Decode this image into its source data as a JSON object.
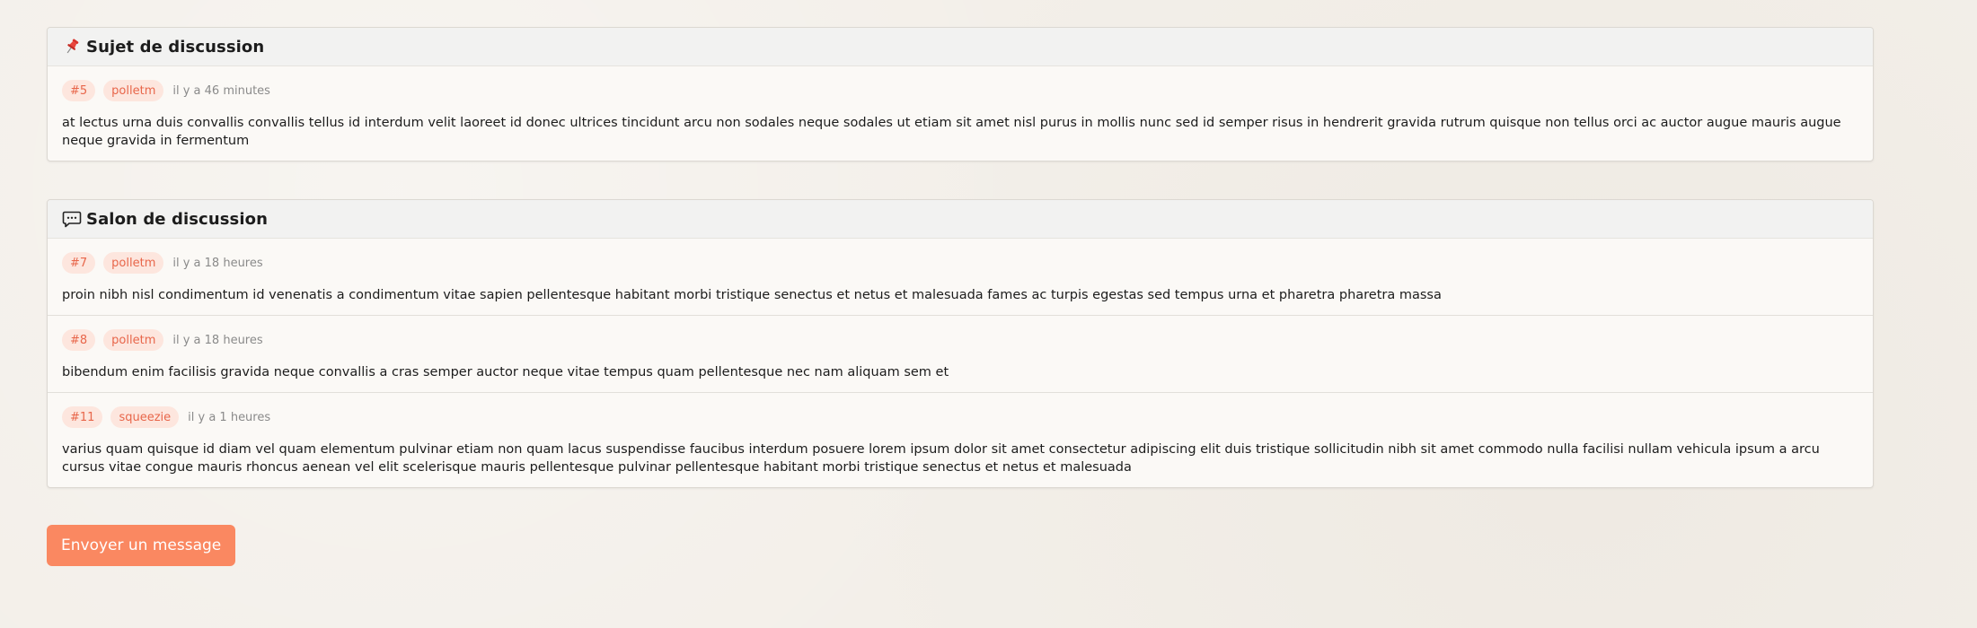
{
  "subject": {
    "title": "Sujet de discussion",
    "icon": "pushpin-icon",
    "message": {
      "id": "#5",
      "author": "polletm",
      "time": "il y a 46 minutes",
      "text": "at lectus urna duis convallis convallis tellus id interdum velit laoreet id donec ultrices tincidunt arcu non sodales neque sodales ut etiam sit amet nisl purus in mollis nunc sed id semper risus in hendrerit gravida rutrum quisque non tellus orci ac auctor augue mauris augue neque gravida in fermentum"
    }
  },
  "chat": {
    "title": "Salon de discussion",
    "icon": "chat-bubble-icon",
    "messages": [
      {
        "id": "#7",
        "author": "polletm",
        "time": "il y a 18 heures",
        "text": "proin nibh nisl condimentum id venenatis a condimentum vitae sapien pellentesque habitant morbi tristique senectus et netus et malesuada fames ac turpis egestas sed tempus urna et pharetra pharetra massa"
      },
      {
        "id": "#8",
        "author": "polletm",
        "time": "il y a 18 heures",
        "text": "bibendum enim facilisis gravida neque convallis a cras semper auctor neque vitae tempus quam pellentesque nec nam aliquam sem et"
      },
      {
        "id": "#11",
        "author": "squeezie",
        "time": "il y a 1 heures",
        "text": "varius quam quisque id diam vel quam elementum pulvinar etiam non quam lacus suspendisse faucibus interdum posuere lorem ipsum dolor sit amet consectetur adipiscing elit duis tristique sollicitudin nibh sit amet commodo nulla facilisi nullam vehicula ipsum a arcu cursus vitae congue mauris rhoncus aenean vel elit scelerisque mauris pellentesque pulvinar pellentesque habitant morbi tristique senectus et netus et malesuada"
      }
    ]
  },
  "actions": {
    "send_label": "Envoyer un message"
  },
  "colors": {
    "accent": "#fa8861",
    "badge_bg": "#fde6de",
    "badge_text": "#e8664a"
  }
}
